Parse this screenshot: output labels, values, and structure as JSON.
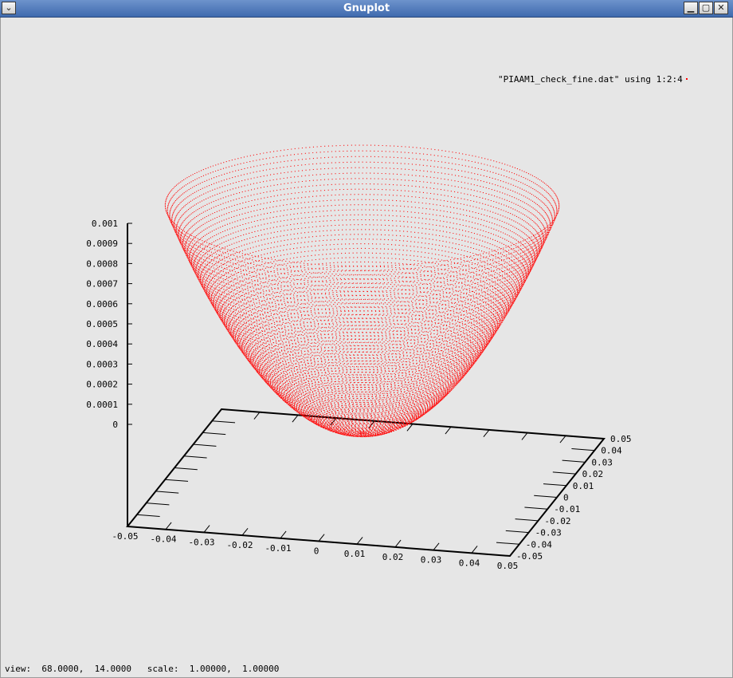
{
  "window": {
    "title": "Gnuplot",
    "menu_icon": "chevron-down-icon",
    "minimize_icon": "minimize-icon",
    "maximize_icon": "maximize-icon",
    "close_icon": "close-icon"
  },
  "legend": {
    "label": "\"PIAAM1_check_fine.dat\" using 1:2:4"
  },
  "status": {
    "text": "view:  68.0000,  14.0000   scale:  1.00000,  1.00000"
  },
  "colors": {
    "background": "#e6e6e6",
    "series": "#ff0000",
    "titlebar": "#4f79bd"
  },
  "chart_data": {
    "type": "scatter",
    "plot_style": "3d points (splot)",
    "title": "",
    "xlabel": "",
    "ylabel": "",
    "zlabel": "",
    "xlim": [
      -0.05,
      0.05
    ],
    "ylim": [
      -0.05,
      0.05
    ],
    "zlim": [
      0,
      0.001
    ],
    "view": {
      "rot_x": 68.0,
      "rot_z": 14.0,
      "scale": 1.0,
      "scale_z": 1.0
    },
    "x_ticks": [
      "-0.05",
      "-0.04",
      "-0.03",
      "-0.02",
      "-0.01",
      "0",
      "0.01",
      "0.02",
      "0.03",
      "0.04",
      "0.05"
    ],
    "y_ticks": [
      "-0.05",
      "-0.04",
      "-0.03",
      "-0.02",
      "-0.01",
      "0",
      "0.01",
      "0.02",
      "0.03",
      "0.04",
      "0.05"
    ],
    "z_ticks": [
      "0",
      "0.0001",
      "0.0002",
      "0.0003",
      "0.0004",
      "0.0005",
      "0.0006",
      "0.0007",
      "0.0008",
      "0.0009",
      "0.001"
    ],
    "series": [
      {
        "name": "\"PIAAM1_check_fine.dat\" using 1:2:4",
        "color": "#ff0000",
        "shape": "paraboloid bowl sampled on concentric rings",
        "center_xy": [
          0,
          0
        ],
        "max_radius": 0.05,
        "z_at_center": 0.0002,
        "z_at_max_radius": 0.00133
      }
    ]
  }
}
